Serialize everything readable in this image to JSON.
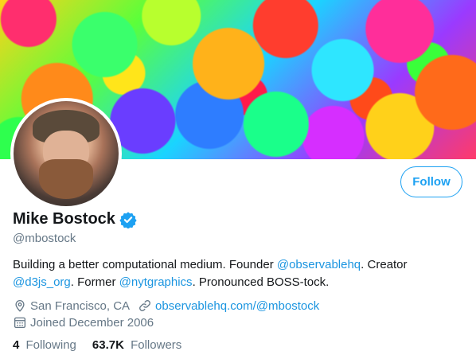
{
  "profile": {
    "name": "Mike Bostock",
    "handle": "@mbostock",
    "follow_label": "Follow",
    "bio": {
      "part1": "Building a better computational medium. Founder ",
      "link1": "@observablehq",
      "part2": ". Creator ",
      "link2": "@d3js_org",
      "part3": ". Former ",
      "link3": "@nytgraphics",
      "part4": ". Pronounced BOSS-tock."
    },
    "location": "San Francisco, CA",
    "website": "observablehq.com/@mbostock",
    "joined": "Joined December 2006",
    "stats": {
      "following_count": "4",
      "following_label": "Following",
      "followers_count": "63.7K",
      "followers_label": "Followers"
    }
  },
  "icons": {
    "verified": "verified-badge-icon",
    "location": "location-pin-icon",
    "link": "link-icon",
    "calendar": "calendar-icon"
  },
  "colors": {
    "accent": "#1da1f2",
    "link": "#1b95e0",
    "secondary_text": "#657786",
    "primary_text": "#14171a"
  }
}
